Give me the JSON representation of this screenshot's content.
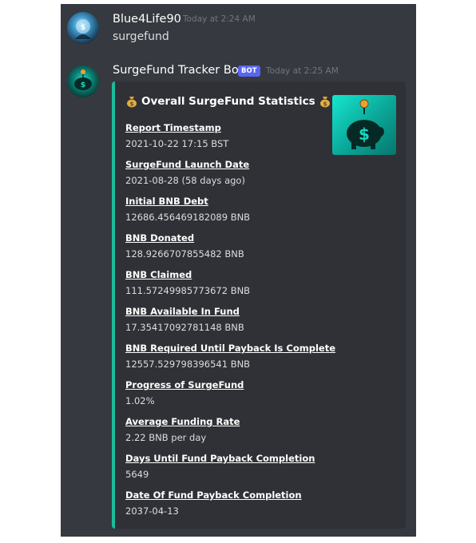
{
  "messages": [
    {
      "username": "Blue4Life90",
      "timestamp": "Today at 2:24 AM",
      "text": "surgefund",
      "avatar_icon": "user-avatar-icon"
    },
    {
      "username": "SurgeFund Tracker Bot",
      "badge": "BOT",
      "timestamp": "Today at 2:25 AM",
      "avatar_icon": "piggy-bank-avatar-icon",
      "embed": {
        "title": "Overall SurgeFund Statistics",
        "title_icon": "money-bag-icon",
        "accent_color": "#1abc9c",
        "thumbnail_icon": "piggy-bank-icon",
        "fields": [
          {
            "name": "Report Timestamp",
            "value": "2021-10-22 17:15 BST"
          },
          {
            "name": "SurgeFund Launch Date",
            "value": "2021-08-28 (58 days ago)"
          },
          {
            "name": "Initial BNB Debt",
            "value": "12686.456469182089 BNB"
          },
          {
            "name": "BNB Donated",
            "value": "128.9266707855482 BNB"
          },
          {
            "name": "BNB Claimed",
            "value": "111.57249985773672 BNB"
          },
          {
            "name": "BNB Available In Fund",
            "value": "17.35417092781148 BNB"
          },
          {
            "name": "BNB Required Until Payback Is Complete",
            "value": "12557.529798396541 BNB"
          },
          {
            "name": "Progress of SurgeFund",
            "value": "1.02%"
          },
          {
            "name": "Average Funding Rate",
            "value": "2.22 BNB per day"
          },
          {
            "name": "Days Until Fund Payback Completion",
            "value": "5649"
          },
          {
            "name": "Date Of Fund Payback Completion",
            "value": "2037-04-13"
          }
        ]
      }
    }
  ],
  "colors": {
    "background": "#36393f",
    "embed_background": "#2f3136",
    "bot_badge": "#5865f2"
  }
}
